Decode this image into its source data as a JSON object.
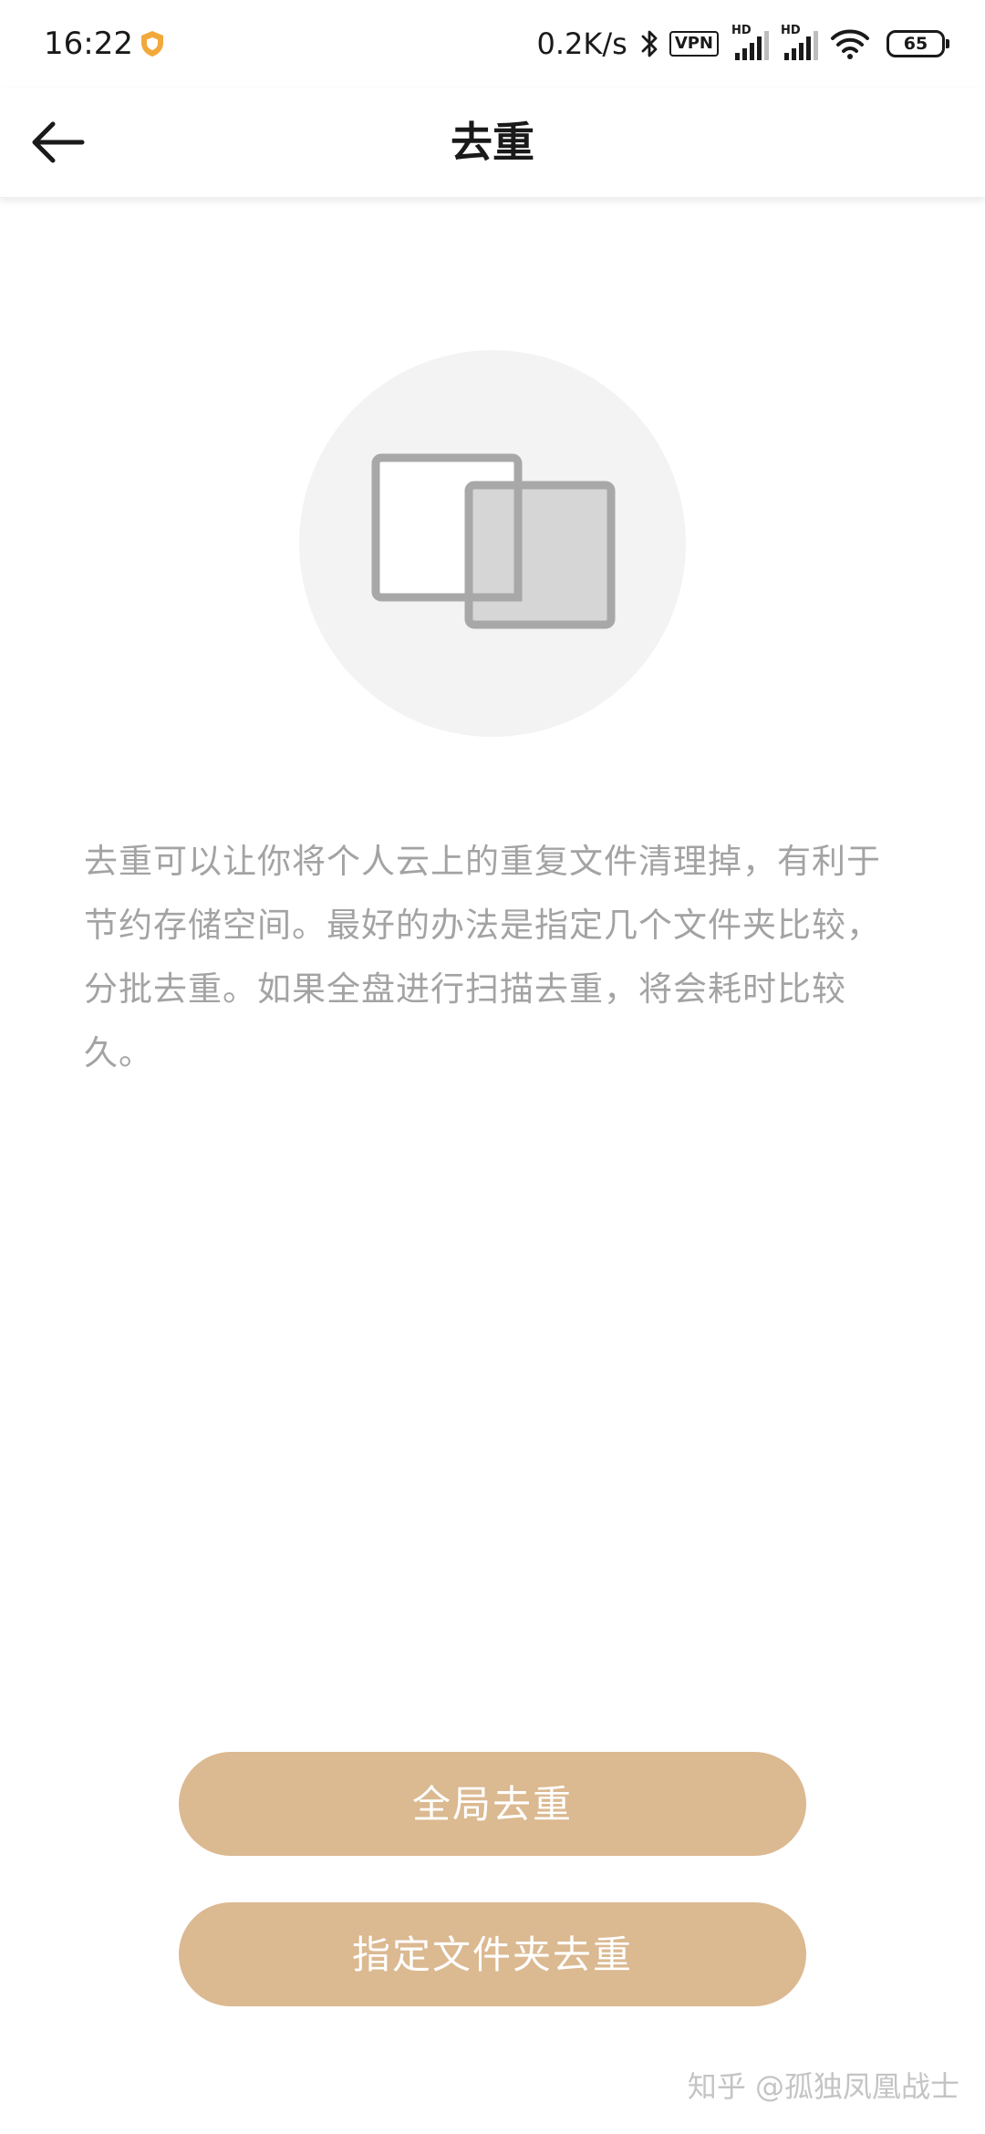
{
  "status_bar": {
    "time": "16:22",
    "network_speed": "0.2K/s",
    "vpn_label": "VPN",
    "hd_label_1": "HD",
    "hd_label_2": "HD",
    "battery_level": "65",
    "icons": [
      "shield-icon",
      "bluetooth-icon",
      "signal-icon",
      "signal-icon",
      "wifi-icon",
      "battery-icon"
    ]
  },
  "header": {
    "title": "去重",
    "back_icon": "arrow-left-icon"
  },
  "illustration": {
    "icon": "duplicate-files-icon"
  },
  "description": "去重可以让你将个人云上的重复文件清理掉，有利于节约存储空间。最好的办法是指定几个文件夹比较，分批去重。如果全盘进行扫描去重，将会耗时比较久。",
  "actions": {
    "global_dedupe_label": "全局去重",
    "folder_dedupe_label": "指定文件夹去重"
  },
  "watermark": "知乎 @孤独凤凰战士",
  "colors": {
    "accent": "#dbb991",
    "description_text": "#a3a3a3",
    "illustration_bg": "#f3f3f3",
    "icon_stroke": "#a8a8a8",
    "icon_fill": "#d6d6d6",
    "shield": "#f2a93b"
  }
}
